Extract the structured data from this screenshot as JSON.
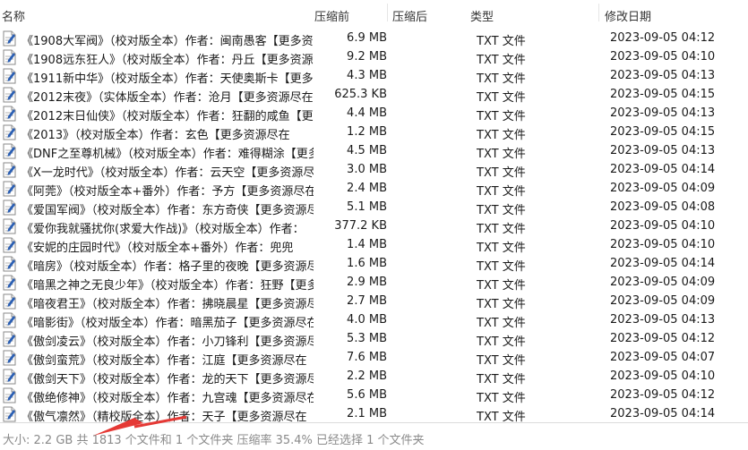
{
  "header": {
    "name": "名称",
    "packed": "压缩前",
    "compressed": "压缩后",
    "type": "类型",
    "modified": "修改日期"
  },
  "files": [
    {
      "name": "《1908大军阀》（校对版全本）作者：闽南愚客【更多资源尽在",
      "size": "6.9 MB",
      "type": "TXT 文件",
      "date": "2023-09-05 04:12"
    },
    {
      "name": "《1908远东狂人》（校对版全本）作者：丹丘【更多资源尽在",
      "size": "9.2 MB",
      "type": "TXT 文件",
      "date": "2023-09-05 04:10"
    },
    {
      "name": "《1911新中华》（校对版全本）作者：天使奥斯卡【更多资源",
      "size": "4.3 MB",
      "type": "TXT 文件",
      "date": "2023-09-05 04:13"
    },
    {
      "name": "《2012末夜》（实体版全本）作者：沧月【更多资源尽在",
      "size": "625.3 KB",
      "type": "TXT 文件",
      "date": "2023-09-05 04:15"
    },
    {
      "name": "《2012末日仙侠》（校对版全本）作者：狂翻的咸鱼【更多资源",
      "size": "4.4 MB",
      "type": "TXT 文件",
      "date": "2023-09-05 04:13"
    },
    {
      "name": "《2013》（校对版全本）作者：玄色【更多资源尽在",
      "size": "1.2 MB",
      "type": "TXT 文件",
      "date": "2023-09-05 04:15"
    },
    {
      "name": "《DNF之至尊机械》（校对版全本）作者：难得糊涂【更多资源",
      "size": "4.5 MB",
      "type": "TXT 文件",
      "date": "2023-09-05 04:13"
    },
    {
      "name": "《X一龙时代》（校对版全本）作者：云天空【更多资源尽在",
      "size": "3.0 MB",
      "type": "TXT 文件",
      "date": "2023-09-05 04:14"
    },
    {
      "name": "《阿莞》（校对版全本+番外）作者：予方【更多资源尽在",
      "size": "2.4 MB",
      "type": "TXT 文件",
      "date": "2023-09-05 04:09"
    },
    {
      "name": "《爱国军阀》（校对版全本）作者：东方奇侠【更多资源尽在",
      "size": "5.1 MB",
      "type": "TXT 文件",
      "date": "2023-09-05 04:08"
    },
    {
      "name": "《爱你我就骚扰你(求爱大作战)》（校对版全本）作者：",
      "size": "377.2 KB",
      "type": "TXT 文件",
      "date": "2023-09-05 04:10"
    },
    {
      "name": "《安妮的庄园时代》（校对版全本+番外）作者：兜兜",
      "size": "1.4 MB",
      "type": "TXT 文件",
      "date": "2023-09-05 04:10"
    },
    {
      "name": "《暗房》（校对版全本）作者：格子里的夜晚【更多资源尽在",
      "size": "1.6 MB",
      "type": "TXT 文件",
      "date": "2023-09-05 04:14"
    },
    {
      "name": "《暗黑之神之无良少年》（校对版全本）作者：狂野【更多",
      "size": "2.9 MB",
      "type": "TXT 文件",
      "date": "2023-09-05 04:09"
    },
    {
      "name": "《暗夜君王》（校对版全本）作者：拂晓晨星【更多资源尽在",
      "size": "2.7 MB",
      "type": "TXT 文件",
      "date": "2023-09-05 04:09"
    },
    {
      "name": "《暗影街》（校对版全本）作者：暗黑茄子【更多资源尽在",
      "size": "4.0 MB",
      "type": "TXT 文件",
      "date": "2023-09-05 04:13"
    },
    {
      "name": "《傲剑凌云》（校对版全本）作者：小刀锋利【更多资源尽在",
      "size": "5.3 MB",
      "type": "TXT 文件",
      "date": "2023-09-05 04:12"
    },
    {
      "name": "《傲剑蛮荒》（校对版全本）作者：江庭【更多资源尽在",
      "size": "7.6 MB",
      "type": "TXT 文件",
      "date": "2023-09-05 04:07"
    },
    {
      "name": "《傲剑天下》（校对版全本）作者：龙的天下【更多资源尽在",
      "size": "2.2 MB",
      "type": "TXT 文件",
      "date": "2023-09-05 04:10"
    },
    {
      "name": "《傲绝修神》（校对版全本）作者：九宫魂【更多资源尽在",
      "size": "5.6 MB",
      "type": "TXT 文件",
      "date": "2023-09-05 04:12"
    },
    {
      "name": "《傲气凛然》（精校版全本）作者：天子【更多资源尽在",
      "size": "2.1 MB",
      "type": "TXT 文件",
      "date": "2023-09-05 04:14"
    }
  ],
  "status": {
    "text": "大小: 2.2 GB 共 1813 个文件和 1 个文件夹 压缩率 35.4% 已经选择 1 个文件夹"
  },
  "colors": {
    "cursor": "#e53935",
    "icon_accent": "#2b5fb3"
  },
  "icons": {
    "file": "txt-file-icon",
    "cursor": "arrow-cursor-icon"
  }
}
